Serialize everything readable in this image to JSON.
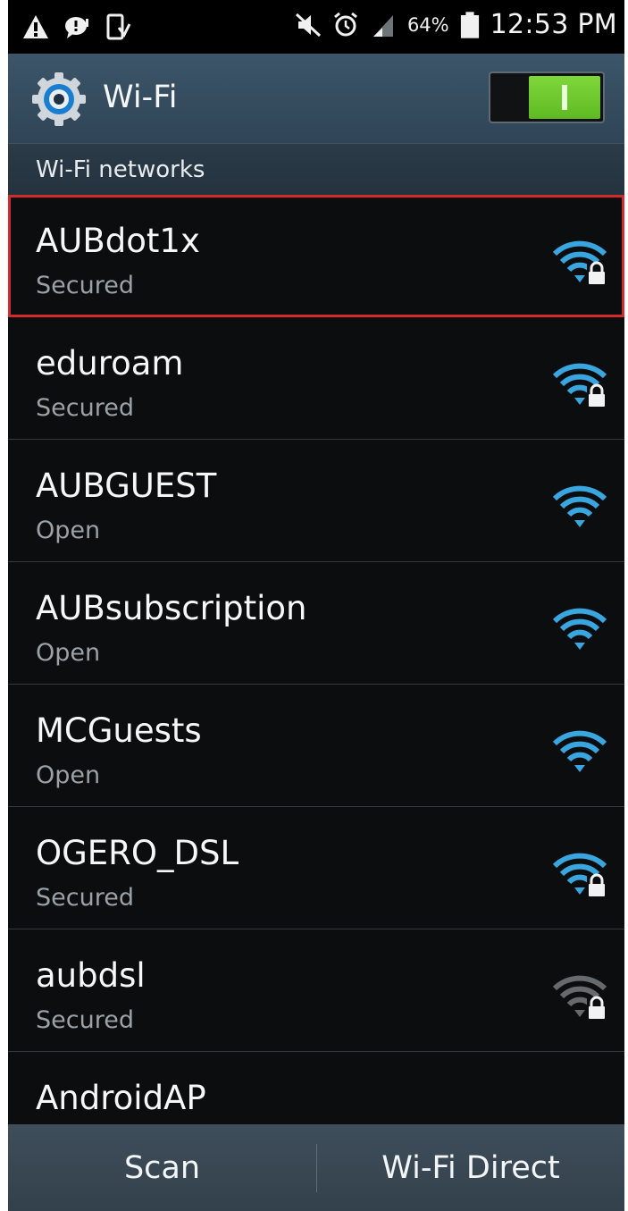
{
  "status_bar": {
    "icons": [
      "warning-icon",
      "message-icon",
      "phone-download-icon",
      "mute-icon",
      "alarm-icon",
      "signal-icon"
    ],
    "battery_percent": "64%",
    "time": "12:53 PM"
  },
  "action_bar": {
    "title": "Wi-Fi",
    "icon": "settings-gear-icon",
    "toggle_on": true
  },
  "section_header": "Wi-Fi networks",
  "networks": [
    {
      "name": "AUBdot1x",
      "status": "Secured",
      "icon": "wifi-locked-icon",
      "signal_color": "#3aa6df",
      "highlighted": true
    },
    {
      "name": "eduroam",
      "status": "Secured",
      "icon": "wifi-locked-icon",
      "signal_color": "#3aa6df"
    },
    {
      "name": "AUBGUEST",
      "status": "Open",
      "icon": "wifi-icon",
      "signal_color": "#3aa6df"
    },
    {
      "name": "AUBsubscription",
      "status": "Open",
      "icon": "wifi-icon",
      "signal_color": "#3aa6df"
    },
    {
      "name": "MCGuests",
      "status": "Open",
      "icon": "wifi-icon",
      "signal_color": "#3aa6df"
    },
    {
      "name": "OGERO_DSL",
      "status": "Secured",
      "icon": "wifi-locked-icon",
      "signal_color": "#3aa6df"
    },
    {
      "name": "aubdsl",
      "status": "Secured",
      "icon": "wifi-locked-icon",
      "signal_color": "#666a6d"
    },
    {
      "name": "AndroidAP",
      "status": "",
      "icon": "",
      "signal_color": ""
    }
  ],
  "bottom_bar": {
    "scan_label": "Scan",
    "wifi_direct_label": "Wi-Fi Direct"
  },
  "colors": {
    "accent": "#3aa6df",
    "toggle_on": "#6bc92e",
    "highlight_border": "#d32a2e"
  }
}
